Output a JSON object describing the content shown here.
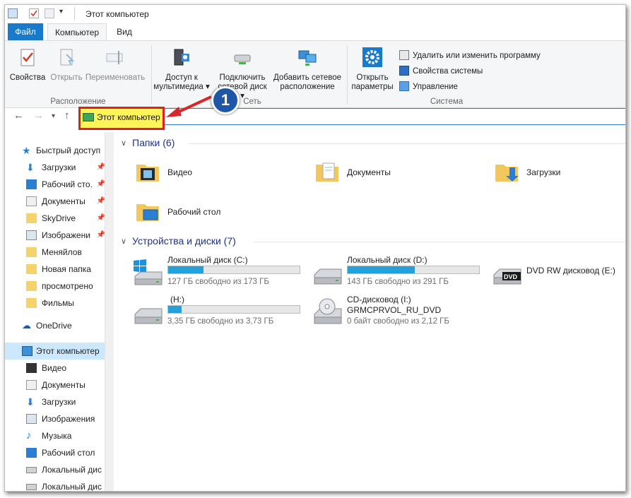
{
  "window": {
    "title": "Этот компьютер"
  },
  "tabs": {
    "file": "Файл",
    "computer": "Компьютер",
    "view": "Вид"
  },
  "ribbon": {
    "location": {
      "properties": "Свойства",
      "open": "Открыть",
      "rename": "Переименовать",
      "group": "Расположение"
    },
    "network": {
      "media_access_1": "Доступ к",
      "media_access_2": "мультимедиа",
      "map_drive_1": "Подключить",
      "map_drive_2": "сетевой диск",
      "add_location_1": "Добавить сетевое",
      "add_location_2": "расположение",
      "group": "Сеть"
    },
    "system": {
      "open_settings_1": "Открыть",
      "open_settings_2": "параметры",
      "uninstall": "Удалить или изменить программу",
      "system_props": "Свойства системы",
      "manage": "Управление",
      "group": "Система"
    }
  },
  "address": {
    "path": "Этот компьютер",
    "callout": "1"
  },
  "nav": {
    "quick_access": "Быстрый доступ",
    "items_pinned": [
      "Загрузки",
      "Рабочий сто.",
      "Документы",
      "SkyDrive",
      "Изображени"
    ],
    "items_recent": [
      "Меняйлов",
      "Новая папка",
      "просмотрено",
      "Фильмы"
    ],
    "onedrive": "OneDrive",
    "this_pc": "Этот компьютер",
    "pc_items": [
      "Видео",
      "Документы",
      "Загрузки",
      "Изображения",
      "Музыка",
      "Рабочий стол",
      "Локальный дис",
      "Локальный дис"
    ]
  },
  "content": {
    "folders_header": "Папки (6)",
    "folders": [
      "Видео",
      "Документы",
      "Загрузки",
      "Рабочий стол"
    ],
    "devices_header": "Устройства и диски (7)",
    "drives": [
      {
        "name": "Локальный диск (C:)",
        "free": "127 ГБ свободно из 173 ГБ",
        "used_fraction": 0.27
      },
      {
        "name": "Локальный диск (D:)",
        "free": "143 ГБ свободно из 291 ГБ",
        "used_fraction": 0.51
      },
      {
        "name": "(H:)",
        "free": "3,35 ГБ свободно из 3,73 ГБ",
        "used_fraction": 0.1
      }
    ],
    "dvd": {
      "name": "DVD RW дисковод (E:)",
      "label": "DVD"
    },
    "cd": {
      "name": "CD-дисковод (I:)",
      "volume": "GRMCPRVOL_RU_DVD",
      "free": "0 байт свободно из 2,12 ГБ"
    }
  }
}
